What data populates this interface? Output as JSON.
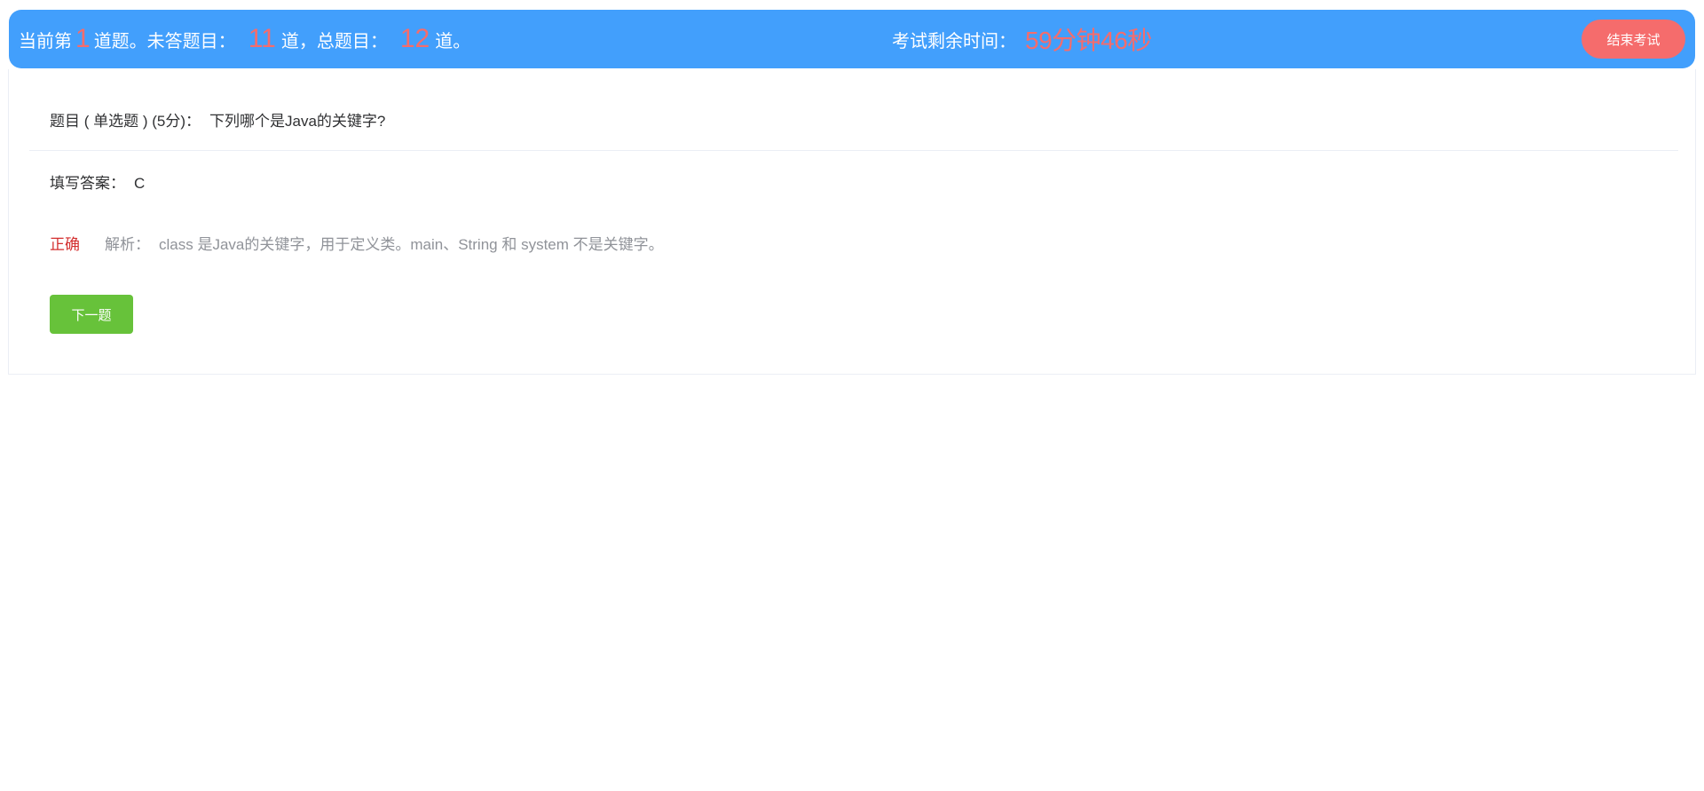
{
  "header": {
    "current_prefix": "当前第",
    "current_number": "1",
    "current_suffix": "道题。未答题目：",
    "unanswered_number": "11",
    "unanswered_suffix": "道，总题目：",
    "total_number": "12",
    "total_suffix": "道。",
    "time_label": "考试剩余时间：",
    "time_value": "59分钟46秒",
    "end_button_label": "结束考试"
  },
  "question": {
    "label": "题目 ( 单选题 ) (5分)：",
    "text": "下列哪个是Java的关键字?"
  },
  "answer": {
    "label": "填写答案：",
    "value": "C"
  },
  "result": {
    "status": "正确",
    "explanation_label": "解析：",
    "explanation_text": "class 是Java的关键字，用于定义类。main、String 和 system 不是关键字。"
  },
  "next_button_label": "下一题",
  "colors": {
    "header_bg": "#429ffc",
    "accent_red": "#f56c6c",
    "status_red": "#d32f2f",
    "next_green": "#67c23a",
    "muted_text": "#909399"
  }
}
